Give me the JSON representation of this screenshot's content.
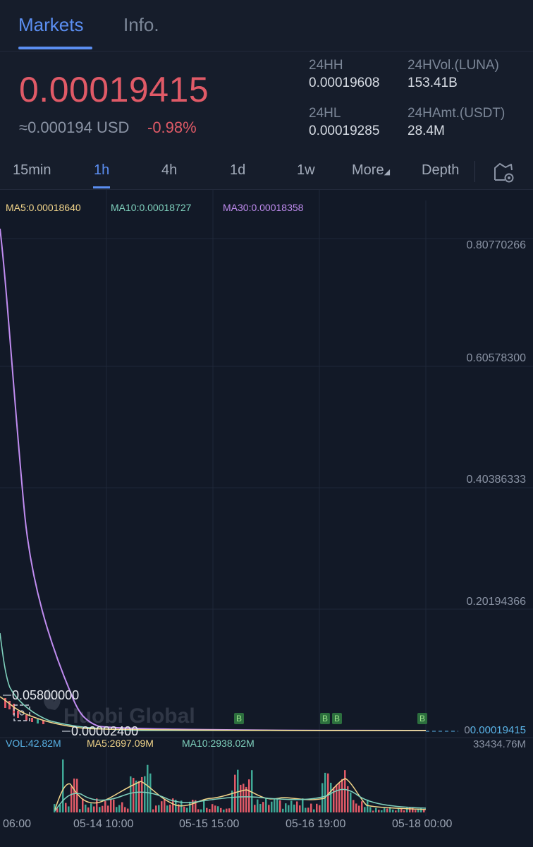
{
  "tabs": {
    "markets": "Markets",
    "info": "Info."
  },
  "ticker": {
    "price": "0.00019415",
    "usd": "≈0.000194 USD",
    "change": "-0.98%",
    "h_label": "24HH",
    "h_value": "0.00019608",
    "l_label": "24HL",
    "l_value": "0.00019285",
    "vol_label": "24HVol.(LUNA)",
    "vol_value": "153.41B",
    "amt_label": "24HAmt.(USDT)",
    "amt_value": "28.4M"
  },
  "periods": {
    "p15": "15min",
    "p1h": "1h",
    "p4h": "4h",
    "p1d": "1d",
    "p1w": "1w",
    "more": "More",
    "depth": "Depth"
  },
  "icons": {
    "settings": "chart-settings-icon",
    "more": "caret-down-icon"
  },
  "colors": {
    "accent": "#5b8ef1",
    "down": "#e05a67",
    "up": "#3ea896",
    "ma5": "#f2d58a",
    "ma10": "#7fd1bd",
    "ma30": "#c08cf0",
    "vol": "#5ab4e8"
  },
  "ma": {
    "ma5": "MA5:0.00018640",
    "ma10": "MA10:0.00018727",
    "ma30": "MA30:0.00018358"
  },
  "price_axis": [
    "0.80770266",
    "0.60578300",
    "0.40386333",
    "0.20194366",
    "0.00019415"
  ],
  "annotations": {
    "high": "0.05800000",
    "low": "0.00002400",
    "last": "0.00019415",
    "watermark": "Huobi Global",
    "buy_marker": "B"
  },
  "volume": {
    "vol": "VOL:42.82M",
    "ma5": "MA5:2697.09M",
    "ma10": "MA10:2938.02M",
    "axis_max": "33434.76M"
  },
  "time_axis": [
    "06:00",
    "05-14 10:00",
    "05-15 15:00",
    "05-16 19:00",
    "05-18 00:00"
  ]
}
